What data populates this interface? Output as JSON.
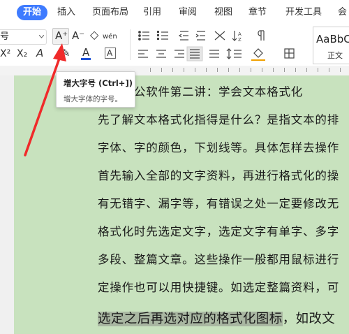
{
  "ribbon_tabs": [
    "开始",
    "插入",
    "页面布局",
    "引用",
    "审阅",
    "视图",
    "章节",
    "开发工具",
    "会"
  ],
  "toolbar": {
    "font_size_fragment": "号",
    "increase_font_glyph": "A⁺",
    "decrease_font_glyph": "A⁻",
    "clear_format_glyph": "◇",
    "phonetic_glyph": "wén",
    "superscript_glyph": "X²",
    "subscript_glyph": "X₂",
    "text_effect_glyph": "A",
    "highlight_glyph": "✎",
    "font_color_glyph": "A",
    "char_border_glyph": "A",
    "style_preview_text": "AaBbC",
    "style_name": "正文"
  },
  "tooltip": {
    "title": "增大字号 (Ctrl+])",
    "description": "增大字体的字号。"
  },
  "document": {
    "lines": [
      "小时办公软件第二讲：学会文本格式化",
      "先了解文本格式化指得是什么？是指文本的排",
      "字体、字的颜色，下划线等。具体怎样去操作",
      "首先输入全部的文字资料，再进行格式化的操",
      "有无错字、漏字等，有错误之处一定要修改无",
      "格式化时先选定文字，选定文字有单字、多字",
      "多段、整篇文章。这些操作一般都用鼠标进行",
      "定操作也可以用快捷键。如选定整篇资料，可"
    ],
    "highlighted_text": "选定之后再选对应的格式化图标",
    "after_highlight": "，如改文"
  },
  "colors": {
    "accent": "#3e7bff",
    "page_background": "#c8e2be",
    "selection_highlight": "#a9b7a2",
    "font_color_underline": "#1e52d8",
    "annotation_arrow": "#f02a2a"
  }
}
